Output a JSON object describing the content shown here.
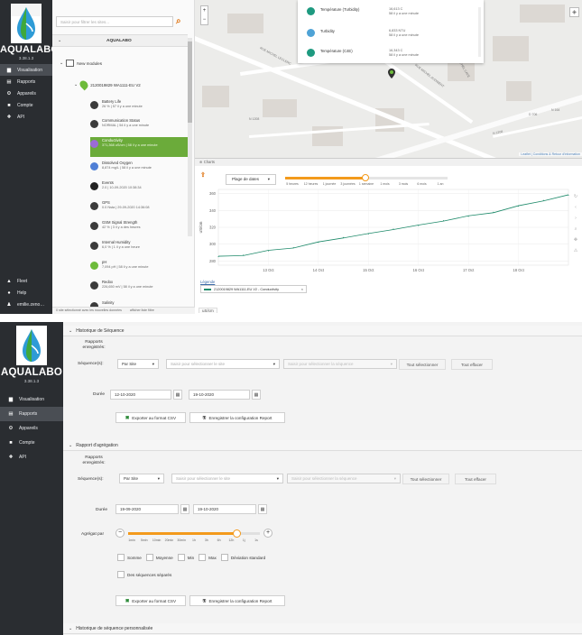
{
  "app": {
    "brand": "AQUALABO",
    "version": "3.38.1.3",
    "nav": [
      {
        "label": "Visualisation",
        "icon": "chart-icon"
      },
      {
        "label": "Rapports",
        "icon": "document-icon"
      },
      {
        "label": "Appareils",
        "icon": "gear-icon"
      },
      {
        "label": "Compte",
        "icon": "user-icon"
      },
      {
        "label": "API",
        "icon": "plug-icon"
      }
    ],
    "bottom_nav": [
      {
        "label": "Fleet",
        "icon": "fleet-icon"
      },
      {
        "label": "Help",
        "icon": "help-icon"
      },
      {
        "label": "emilie.zeno…",
        "icon": "user-icon"
      }
    ]
  },
  "explorer": {
    "search_placeholder": "Saisir pour filtrer les sites...",
    "group_label": "AQUALABO",
    "folder_label": "New modules",
    "device_label": "2120019829 WA1111-EU V2",
    "status_bar": "0 site sélectionné avec les nouvelles données",
    "status_bar_right": "afficher liste filtre",
    "sensors": [
      {
        "name": "Battery Life",
        "value": "26 % | 57 il y a une minute",
        "color": "#3b3b3b"
      },
      {
        "name": "Communication Status",
        "value": "NORMAL | 54 il y a une minute",
        "color": "#3b3b3b"
      },
      {
        "name": "Conductivity",
        "value": "371,368 uS/cm | 58 il y a une minute",
        "color": "#9b6bd6"
      },
      {
        "name": "Dissolved Oxygen",
        "value": "8,874 mg/L | 58 il y a une minute",
        "color": "#4f7fd6"
      },
      {
        "name": "Events",
        "value": "2.0 | 10-09-2020 10:38:34",
        "color": "#222222"
      },
      {
        "name": "GPS",
        "value": "0.0 Nsta | 29-09-2020 14:36:08",
        "color": "#3b3b3b"
      },
      {
        "name": "GSM Signal Strength",
        "value": "42 % | 3 il y a des heures",
        "color": "#3b3b3b"
      },
      {
        "name": "Internal Humidity",
        "value": "6,0 % | 1 il y a une heure",
        "color": "#3b3b3b"
      },
      {
        "name": "pH",
        "value": "7,094 pH | 58 il y a une minute",
        "color": "#6dbb3a"
      },
      {
        "name": "Redox",
        "value": "226,650 mV | 58 il y a une minute",
        "color": "#3b3b3b"
      },
      {
        "name": "Salinity",
        "value": "",
        "color": "#3b3b3b"
      }
    ]
  },
  "map": {
    "popup": [
      {
        "name": "Température (Turbidity)",
        "value": "16,613 C",
        "time": "58 il y a une minute"
      },
      {
        "name": "Turbidity",
        "value": "6,833 NTU",
        "time": "58 il y a une minute"
      },
      {
        "name": "Température (C4E)",
        "value": "16,343 C",
        "time": "58 il y a une minute"
      }
    ],
    "streets": [
      "RUE MICHEL LECLERC",
      "RUE MICHEL AUDIBERT",
      "RUE MICHEL CAVE",
      "N 1208",
      "D 706",
      "N 164",
      "N 1208"
    ],
    "attribution": "Leaflet | Conditions & Retour d'information"
  },
  "chart_panel": {
    "title": "Charts",
    "range_label": "Plage de dates",
    "range_ticks": [
      "5 heures",
      "12 heures",
      "1 journée",
      "3 journées",
      "1 semaine",
      "1 mois",
      "3 mois",
      "6 mois",
      "1 an"
    ],
    "legend_title": "Légende",
    "legend_item": "2120019829 WA1111-EU V2 - Conductivity",
    "y_unit_tab": "uS/cm"
  },
  "chart_data": {
    "type": "line",
    "title": "",
    "xlabel": "",
    "ylabel": "uS/cm",
    "x": [
      "12 Oct",
      "12.5 Oct",
      "13 Oct",
      "13.5 Oct",
      "14 Oct",
      "14.5 Oct",
      "15 Oct",
      "15.5 Oct",
      "16 Oct",
      "16.5 Oct",
      "17 Oct",
      "17.5 Oct",
      "18 Oct",
      "18.5 Oct",
      "19 Oct"
    ],
    "x_ticks": [
      "13 Oct",
      "14 Oct",
      "15 Oct",
      "16 Oct",
      "17 Oct",
      "18 Oct"
    ],
    "y_ticks": [
      280,
      300,
      320,
      340,
      360
    ],
    "ylim": [
      275,
      365
    ],
    "series": [
      {
        "values": [
          285,
          287,
          292,
          296,
          302,
          308,
          312,
          318,
          322,
          328,
          333,
          338,
          345,
          352,
          358
        ],
        "color": "#1e8a6a"
      }
    ],
    "grid": true
  },
  "reports": {
    "sections": [
      {
        "title": "Historique de Séquence",
        "saved_reports_label": "Rapports enregistrés:",
        "sequence_label": "Séquence(s):",
        "by_site": "Par Site",
        "site_placeholder": "Saisir pour sélectionner le site",
        "sequence_placeholder": "Saisir pour sélectionner la séquence",
        "select_all": "Tout sélectionner",
        "clear_all": "Tout effacer",
        "duration_label": "Durée",
        "date_from": "12-10-2020",
        "date_to": "19-10-2020",
        "export_csv": "Exporter au format CSV",
        "save_config": "Enregistrer la configuration Report"
      },
      {
        "title": "Rapport d'agrégation",
        "saved_reports_label": "Rapports enregistrés:",
        "sequence_label": "Séquence(s):",
        "by_site": "Par Site",
        "site_placeholder": "Saisir pour sélectionner le site",
        "sequence_placeholder": "Saisir pour sélectionner la séquence",
        "select_all": "Tout sélectionner",
        "clear_all": "Tout effacer",
        "duration_label": "Durée",
        "date_from": "19-09-2020",
        "date_to": "19-10-2020",
        "aggregate_label": "Agrégat par",
        "slider_ticks": [
          "1min",
          "5min",
          "10min",
          "20min",
          "30min",
          "1h",
          "3h",
          "6h",
          "12h",
          "1j",
          "1s"
        ],
        "slider_level": 0.82,
        "checks": [
          "Somme",
          "Moyenne",
          "Min",
          "Max",
          "Déviation standard"
        ],
        "separate": "Des séquences séparés",
        "export_csv": "Exporter au format CSV",
        "save_config": "Enregistrer la configuration Report"
      }
    ],
    "third_section": "Historique de séquence personnalisée"
  }
}
